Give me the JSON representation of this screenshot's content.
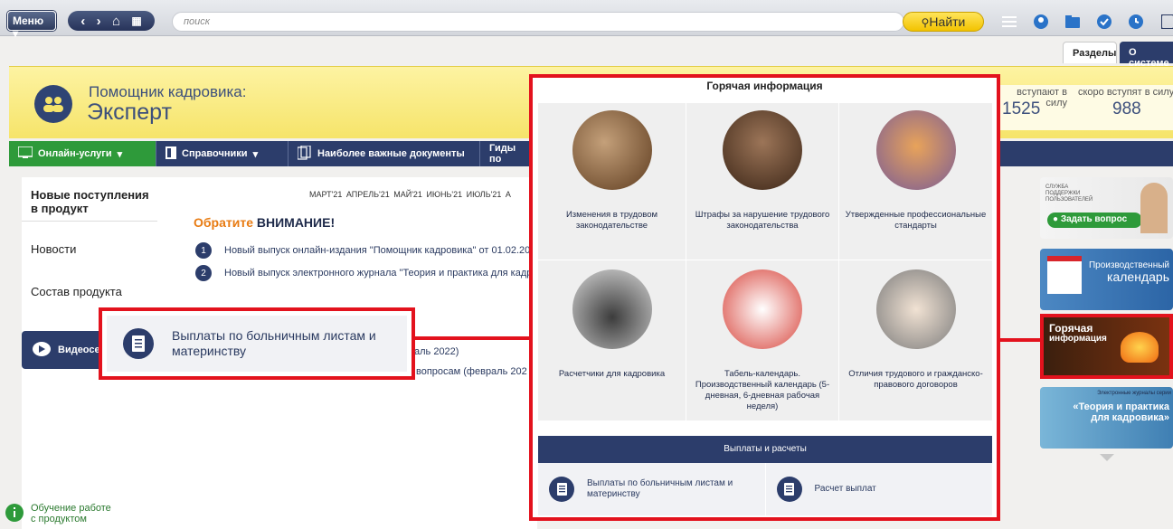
{
  "topbar": {
    "menu_label": "Меню",
    "search_placeholder": "поиск",
    "find_label": "Найти"
  },
  "tabs": {
    "sections": "Разделы",
    "about": "О системе"
  },
  "header": {
    "brand_line1": "Помощник кадровика:",
    "brand_line2": "Эксперт",
    "stats": [
      {
        "label": "вступают в силу",
        "value": "1525"
      },
      {
        "label": "скоро вступят в силу",
        "value": "988"
      }
    ]
  },
  "navbar": {
    "items": [
      "Онлайн-услуги",
      "Справочники",
      "Наиболее важные документы",
      "Гиды по"
    ]
  },
  "sidebar": {
    "items": [
      "Новые поступления в продукт",
      "Новости",
      "Состав продукта"
    ],
    "video_label": "Видеосе",
    "learn_label": "Обучение работе с продуктом"
  },
  "content": {
    "months": "МАРТ'21   АПРЕЛЬ'21   МАЙ'21   ИЮНЬ'21   ИЮЛЬ'21   А",
    "attention_prefix": "Обратите ",
    "attention_strong": "ВНИМАНИЕ!",
    "news": [
      {
        "num": "1",
        "text": "Новый выпуск онлайн-издания \"Помощник кадровика\" от 01.02.202"
      },
      {
        "num": "2",
        "text": "Новый выпуск электронного журнала \"Теория и практика для кадро"
      }
    ],
    "partial_lines": [
      "аль 2022)",
      "вопросам (февраль 202"
    ]
  },
  "popup": {
    "label": "Выплаты по больничным листам и материнству"
  },
  "hot": {
    "title": "Горячая информация",
    "cells": [
      "Изменения в трудовом законодательстве",
      "Штрафы за нарушение трудового законодательства",
      "Утвержденные профессиональные стандарты",
      "Расчетчики для кадровика",
      "Табель-календарь. Производственный календарь (5-дневная, 6-дневная рабочая неделя)",
      "Отличия трудового и гражданско-правового договоров"
    ],
    "band": "Выплаты и расчеты",
    "pay_items": [
      "Выплаты по больничным листам и материнству",
      "Расчет выплат"
    ]
  },
  "right": {
    "support_small": "СЛУЖБА ПОДДЕРЖКИ ПОЛЬЗОВАТЕЛЕЙ",
    "ask": "Задать вопрос",
    "calendar1": "Производственный",
    "calendar2": "календарь",
    "hot1": "Горячая",
    "hot2": "информация",
    "journal_small": "Электронные журналы серии",
    "journal1": "«Теория и практика",
    "journal2": "для кадровика»"
  },
  "colors": {
    "accent_red": "#e3121d",
    "navy": "#2c3d6b",
    "green": "#2e9a3a",
    "yellow": "#f6e46a"
  }
}
